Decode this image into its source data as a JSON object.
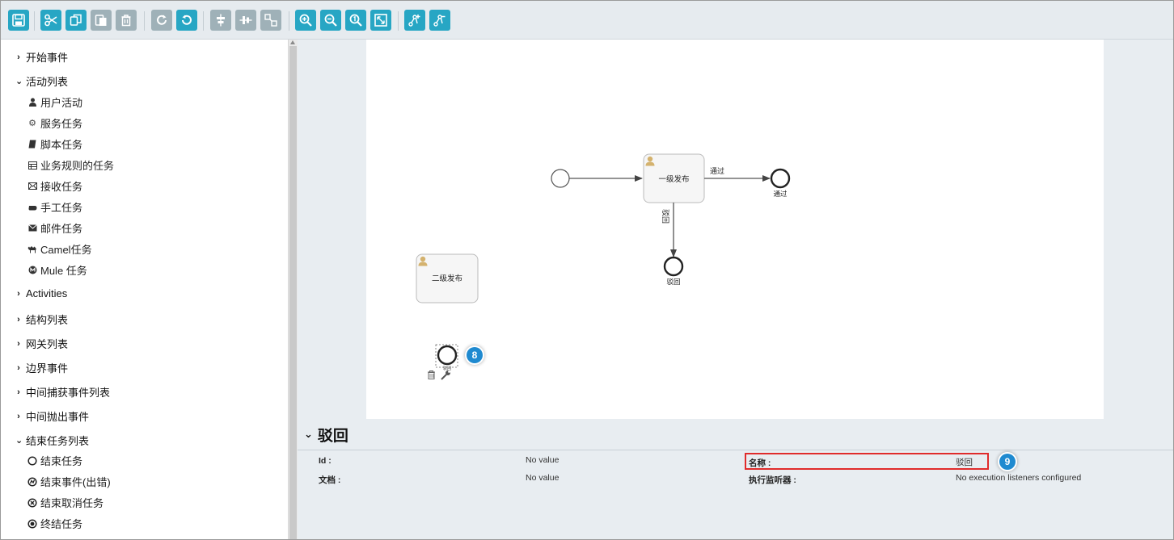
{
  "toolbar": {
    "buttons": [
      {
        "name": "save-icon",
        "state": "active"
      },
      {
        "name": "cut-icon",
        "state": "active"
      },
      {
        "name": "copy-icon",
        "state": "active"
      },
      {
        "name": "paste-icon",
        "state": "disabled"
      },
      {
        "name": "delete-icon",
        "state": "disabled"
      },
      {
        "name": "redo-icon",
        "state": "disabled"
      },
      {
        "name": "undo-icon",
        "state": "active"
      },
      {
        "name": "align-horizontal-icon",
        "state": "disabled"
      },
      {
        "name": "align-vertical-icon",
        "state": "disabled"
      },
      {
        "name": "same-size-icon",
        "state": "disabled"
      },
      {
        "name": "zoom-in-icon",
        "state": "active"
      },
      {
        "name": "zoom-out-icon",
        "state": "active"
      },
      {
        "name": "zoom-actual-icon",
        "state": "active"
      },
      {
        "name": "zoom-fit-icon",
        "state": "active"
      },
      {
        "name": "bend-point-add-icon",
        "state": "active"
      },
      {
        "name": "bend-point-remove-icon",
        "state": "active"
      }
    ],
    "active_color": "#27a6c4",
    "disabled_color": "#9fb1b8"
  },
  "palette": {
    "groups": [
      {
        "label": "开始事件",
        "expanded": false
      },
      {
        "label": "活动列表",
        "expanded": true,
        "items": [
          {
            "label": "用户活动",
            "icon": "user-icon"
          },
          {
            "label": "服务任务",
            "icon": "gear-icon"
          },
          {
            "label": "脚本任务",
            "icon": "script-icon"
          },
          {
            "label": "业务规则的任务",
            "icon": "table-icon"
          },
          {
            "label": "接收任务",
            "icon": "envelope-open-icon"
          },
          {
            "label": "手工任务",
            "icon": "hand-icon"
          },
          {
            "label": "邮件任务",
            "icon": "envelope-icon"
          },
          {
            "label": "Camel任务",
            "icon": "camel-icon"
          },
          {
            "label": "Mule 任务",
            "icon": "mule-icon"
          }
        ]
      },
      {
        "label": "Activities",
        "expanded": false
      },
      {
        "label": "结构列表",
        "expanded": false
      },
      {
        "label": "网关列表",
        "expanded": false
      },
      {
        "label": "边界事件",
        "expanded": false
      },
      {
        "label": "中间捕获事件列表",
        "expanded": false
      },
      {
        "label": "中间抛出事件",
        "expanded": false
      },
      {
        "label": "结束任务列表",
        "expanded": true,
        "items": [
          {
            "label": "结束任务",
            "icon": "end-circle-icon"
          },
          {
            "label": "结束事件(出错)",
            "icon": "error-end-icon"
          },
          {
            "label": "结束取消任务",
            "icon": "cancel-end-icon"
          },
          {
            "label": "终结任务",
            "icon": "terminate-end-icon"
          }
        ]
      }
    ]
  },
  "diagram": {
    "task1": "一级发布",
    "task2": "二级发布",
    "flow_pass": "通过",
    "end_pass": "通过",
    "flow_reject": "驳回",
    "end_reject": "驳回",
    "selected_end_label": "驳回",
    "badge_canvas": "8",
    "user_icon_color": "#d4b26e"
  },
  "properties": {
    "title": "驳回",
    "id_label": "Id :",
    "id_value": "No value",
    "doc_label": "文档 :",
    "doc_value": "No value",
    "name_label": "名称 :",
    "name_value": "驳回",
    "listeners_label": "执行监听器 :",
    "listeners_value": "No execution listeners configured",
    "badge_props": "9"
  }
}
